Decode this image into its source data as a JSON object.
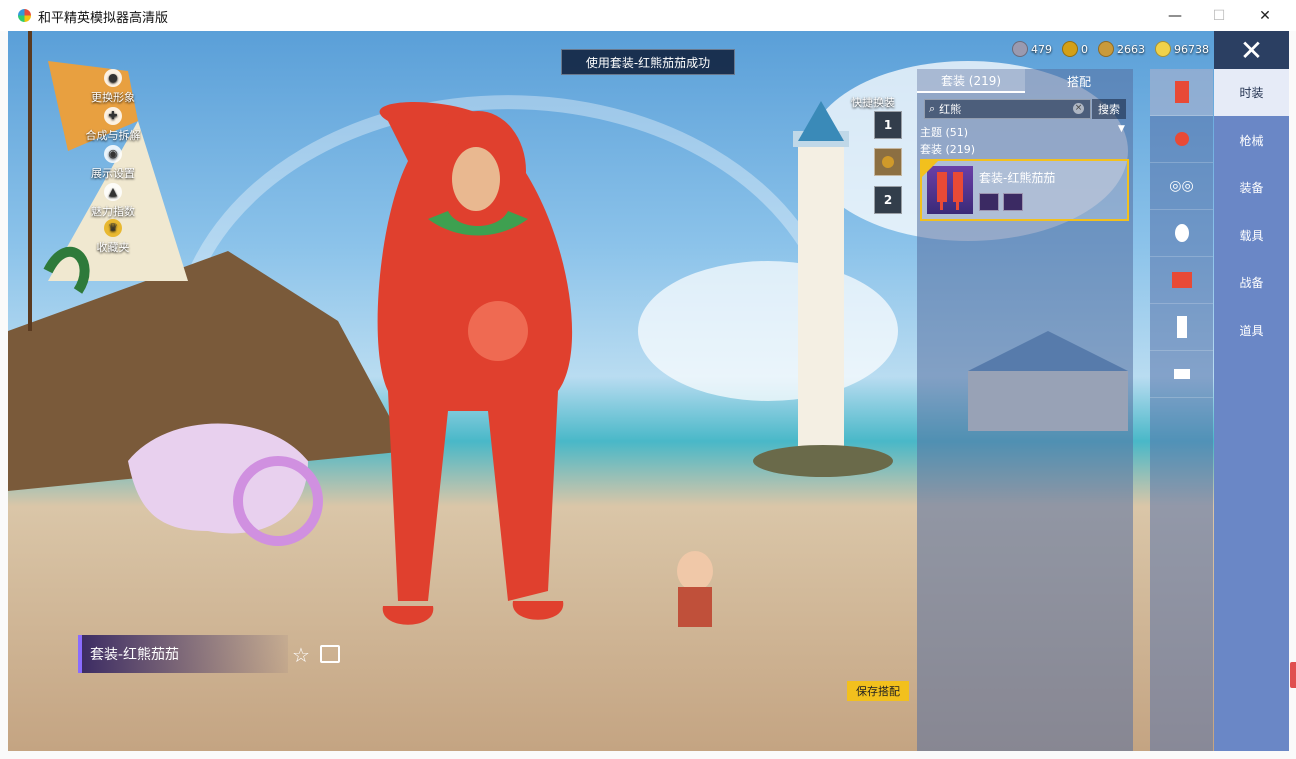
{
  "window": {
    "title": "和平精英模拟器高清版",
    "minimize": "—",
    "maximize": "☐",
    "close": "✕"
  },
  "notice": "使用套装-红熊茄茄成功",
  "left_menu": [
    {
      "label": "更换形象",
      "icon": "person-icon"
    },
    {
      "label": "合成与拆解",
      "icon": "craft-icon"
    },
    {
      "label": "展示设置",
      "icon": "eye-icon"
    },
    {
      "label": "魅力指数",
      "icon": "flame-icon"
    },
    {
      "label": "收藏夹",
      "icon": "crown-icon"
    }
  ],
  "outfit_label": "套装-红熊茄茄",
  "save_button": "保存搭配",
  "quick_change": {
    "label": "快捷换装",
    "slot1": "1",
    "slot2": "2"
  },
  "currency": [
    {
      "value": "479",
      "color": "#9a9ab0",
      "icon": "token-icon"
    },
    {
      "value": "0",
      "color": "#d4a017",
      "icon": "badge-coin-icon"
    },
    {
      "value": "2663",
      "color": "#c99a3a",
      "icon": "bronze-coin-icon"
    },
    {
      "value": "96738",
      "color": "#f0d24a",
      "icon": "gold-coin-icon"
    }
  ],
  "panel": {
    "tabs": [
      "套装 (219)",
      "搭配"
    ],
    "search_value": "红熊",
    "search_button": "搜索",
    "theme": "主题 (51)",
    "suits": "套装 (219)",
    "item": {
      "name": "套装-红熊茄茄",
      "selected": true
    }
  },
  "side_icons": [
    "suit-icon",
    "accessory-icon",
    "glasses-icon",
    "face-icon",
    "top-icon",
    "pants-icon",
    "shoes-icon"
  ],
  "categories": [
    "时装",
    "枪械",
    "装备",
    "载具",
    "战备",
    "道具"
  ],
  "colors": {
    "accent": "#f2c01d",
    "category_bg": "#6a87c6",
    "active_category": "#e6ebf7"
  }
}
